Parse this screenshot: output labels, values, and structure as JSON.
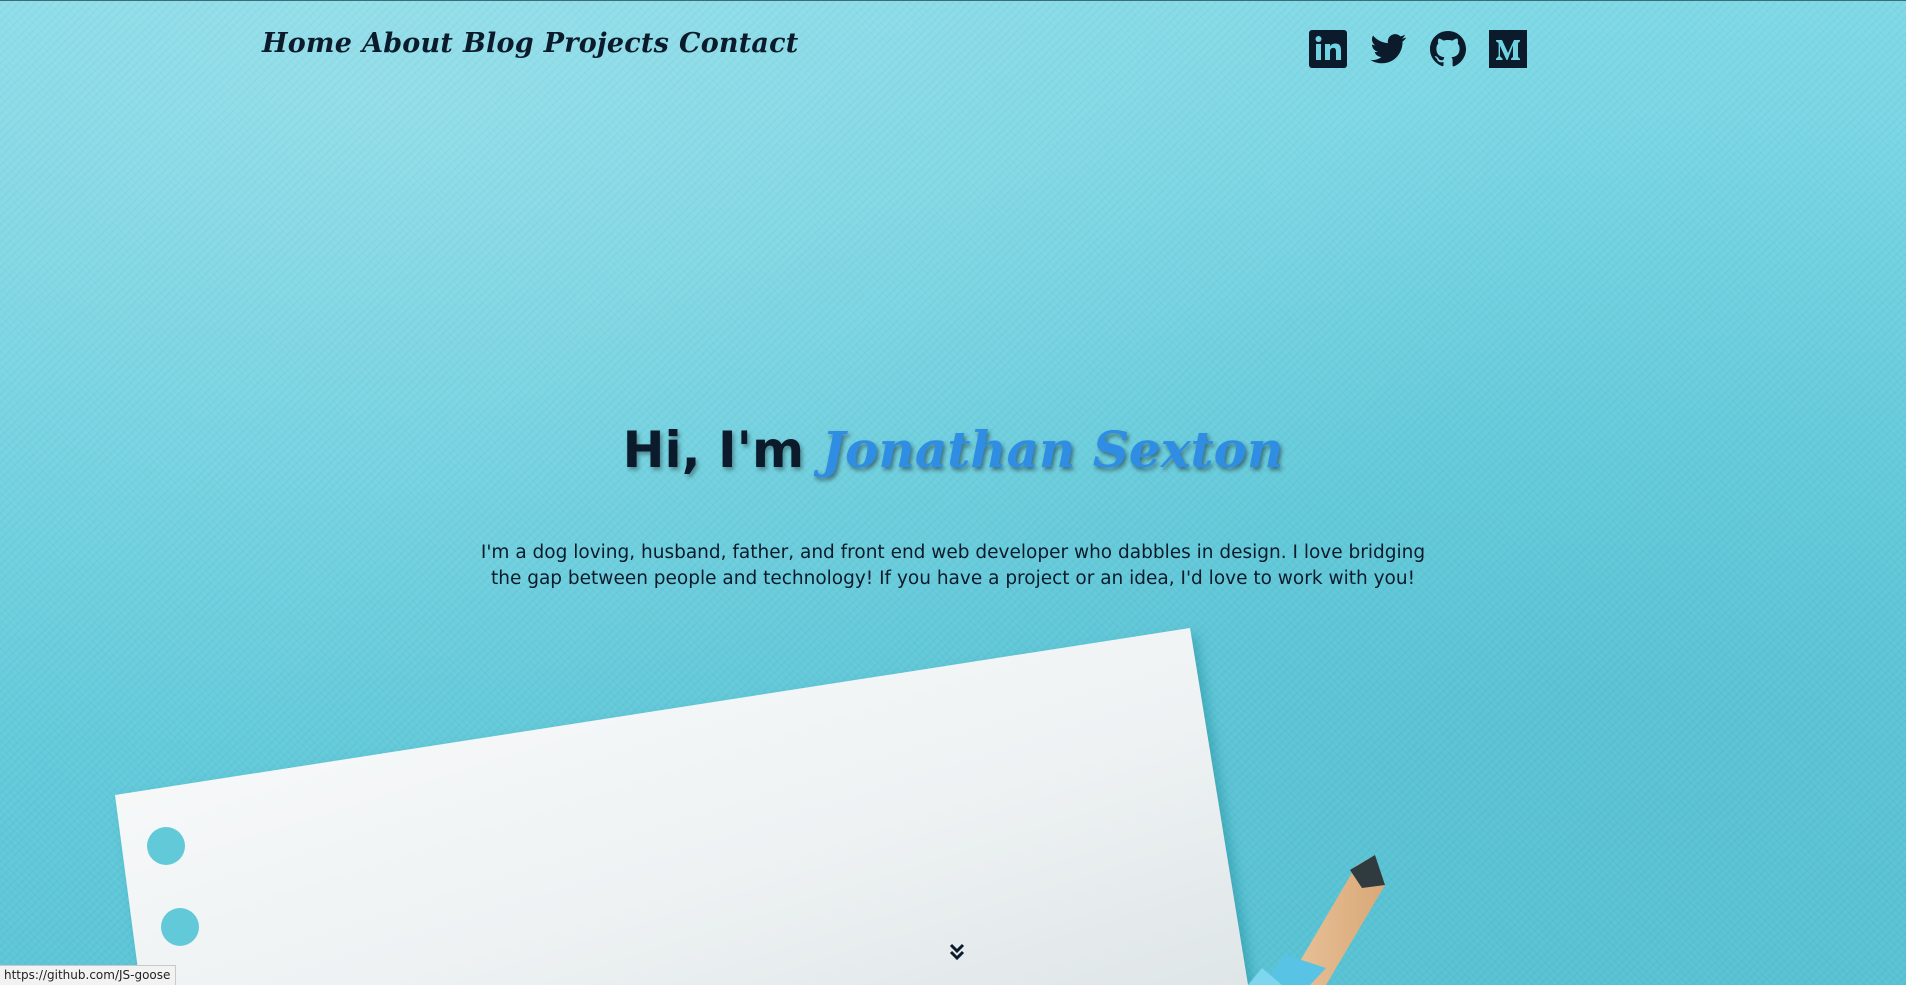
{
  "nav": {
    "items": [
      {
        "label": "Home"
      },
      {
        "label": "About"
      },
      {
        "label": "Blog"
      },
      {
        "label": "Projects"
      },
      {
        "label": "Contact"
      }
    ]
  },
  "social": [
    {
      "icon": "linkedin-icon",
      "label": "in"
    },
    {
      "icon": "twitter-icon"
    },
    {
      "icon": "github-icon"
    },
    {
      "icon": "medium-icon",
      "label": "M"
    }
  ],
  "hero": {
    "greeting": "Hi, I'm ",
    "name": "Jonathan Sexton",
    "description": "I'm a dog loving, husband, father, and front end web developer who dabbles in design. I love bridging the gap between people and technology! If you have a project or an idea, I'd love to work with you!"
  },
  "status_bar": {
    "url": "https://github.com/JS-goose"
  },
  "colors": {
    "background": "#6fd3e1",
    "text": "#0b1b2b",
    "name_accent": "#2f8de4"
  }
}
